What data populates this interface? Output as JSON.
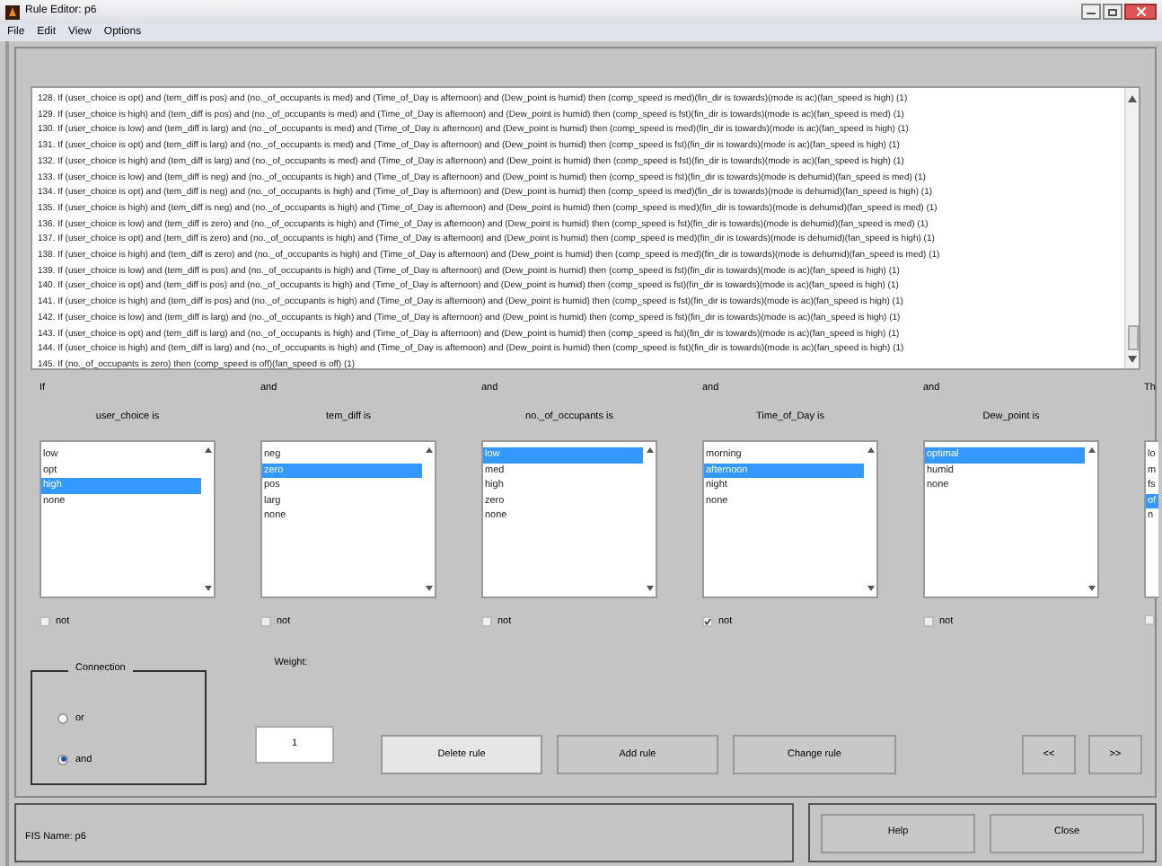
{
  "window": {
    "title": "Rule Editor: p6"
  },
  "menu": [
    "File",
    "Edit",
    "View",
    "Options"
  ],
  "rules": [
    "128. If (user_choice is opt) and (tem_diff is pos) and (no._of_occupants is med) and (Time_of_Day is afternoon) and (Dew_point is humid) then (comp_speed is med)(fin_dir is towards)(mode is ac)(fan_speed is high) (1)",
    "129. If (user_choice is high) and (tem_diff is pos) and (no._of_occupants is med) and (Time_of_Day is afternoon) and (Dew_point is humid) then (comp_speed is fst)(fin_dir is towards)(mode is ac)(fan_speed is med) (1)",
    "130. If (user_choice is low) and (tem_diff is larg) and (no._of_occupants is med) and (Time_of_Day is afternoon) and (Dew_point is humid) then (comp_speed is med)(fin_dir is towards)(mode is ac)(fan_speed is high) (1)",
    "131. If (user_choice is opt) and (tem_diff is larg) and (no._of_occupants is med) and (Time_of_Day is afternoon) and (Dew_point is humid) then (comp_speed is fst)(fin_dir is towards)(mode is ac)(fan_speed is high) (1)",
    "132. If (user_choice is high) and (tem_diff is larg) and (no._of_occupants is med) and (Time_of_Day is afternoon) and (Dew_point is humid) then (comp_speed is fst)(fin_dir is towards)(mode is ac)(fan_speed is high) (1)",
    "133. If (user_choice is low) and (tem_diff is neg) and (no._of_occupants is high) and (Time_of_Day is afternoon) and (Dew_point is humid) then (comp_speed is fst)(fin_dir is towards)(mode is dehumid)(fan_speed is med) (1)",
    "134. If (user_choice is opt) and (tem_diff is neg) and (no._of_occupants is high) and (Time_of_Day is afternoon) and (Dew_point is humid) then (comp_speed is med)(fin_dir is towards)(mode is dehumid)(fan_speed is high) (1)",
    "135. If (user_choice is high) and (tem_diff is neg) and (no._of_occupants is high) and (Time_of_Day is afternoon) and (Dew_point is humid) then (comp_speed is med)(fin_dir is towards)(mode is dehumid)(fan_speed is med) (1)",
    "136. If (user_choice is low) and (tem_diff is zero) and (no._of_occupants is high) and (Time_of_Day is afternoon) and (Dew_point is humid) then (comp_speed is fst)(fin_dir is towards)(mode is dehumid)(fan_speed is med) (1)",
    "137. If (user_choice is opt) and (tem_diff is zero) and (no._of_occupants is high) and (Time_of_Day is afternoon) and (Dew_point is humid) then (comp_speed is med)(fin_dir is towards)(mode is dehumid)(fan_speed is high) (1)",
    "138. If (user_choice is high) and (tem_diff is zero) and (no._of_occupants is high) and (Time_of_Day is afternoon) and (Dew_point is humid) then (comp_speed is med)(fin_dir is towards)(mode is dehumid)(fan_speed is med) (1)",
    "139. If (user_choice is low) and (tem_diff is pos) and (no._of_occupants is high) and (Time_of_Day is afternoon) and (Dew_point is humid) then (comp_speed is fst)(fin_dir is towards)(mode is ac)(fan_speed is high) (1)",
    "140. If (user_choice is opt) and (tem_diff is pos) and (no._of_occupants is high) and (Time_of_Day is afternoon) and (Dew_point is humid) then (comp_speed is fst)(fin_dir is towards)(mode is ac)(fan_speed is high) (1)",
    "141. If (user_choice is high) and (tem_diff is pos) and (no._of_occupants is high) and (Time_of_Day is afternoon) and (Dew_point is humid) then (comp_speed is fst)(fin_dir is towards)(mode is ac)(fan_speed is high) (1)",
    "142. If (user_choice is low) and (tem_diff is larg) and (no._of_occupants is high) and (Time_of_Day is afternoon) and (Dew_point is humid) then (comp_speed is fst)(fin_dir is towards)(mode is ac)(fan_speed is high) (1)",
    "143. If (user_choice is opt) and (tem_diff is larg) and (no._of_occupants is high) and (Time_of_Day is afternoon) and (Dew_point is humid) then (comp_speed is fst)(fin_dir is towards)(mode is ac)(fan_speed is high) (1)",
    "144. If (user_choice is high) and (tem_diff is larg) and (no._of_occupants is high) and (Time_of_Day is afternoon) and (Dew_point is humid) then (comp_speed is fst)(fin_dir is towards)(mode is ac)(fan_speed is high) (1)",
    "145. If (no._of_occupants is zero) then (comp_speed is off)(fan_speed is off) (1)"
  ],
  "variables": [
    {
      "connective": "If",
      "label": "user_choice is",
      "not": false,
      "not_label": "not",
      "options": [
        {
          "label": "low",
          "selected": false
        },
        {
          "label": "opt",
          "selected": false
        },
        {
          "label": "high",
          "selected": true
        },
        {
          "label": "none",
          "selected": false
        }
      ]
    },
    {
      "connective": "and",
      "label": "tem_diff is",
      "not": false,
      "not_label": "not",
      "options": [
        {
          "label": "neg",
          "selected": false
        },
        {
          "label": "zero",
          "selected": true
        },
        {
          "label": "pos",
          "selected": false
        },
        {
          "label": "larg",
          "selected": false
        },
        {
          "label": "none",
          "selected": false
        }
      ]
    },
    {
      "connective": "and",
      "label": "no._of_occupants is",
      "not": false,
      "not_label": "not",
      "options": [
        {
          "label": "low",
          "selected": true
        },
        {
          "label": "med",
          "selected": false
        },
        {
          "label": "high",
          "selected": false
        },
        {
          "label": "zero",
          "selected": false
        },
        {
          "label": "none",
          "selected": false
        }
      ]
    },
    {
      "connective": "and",
      "label": "Time_of_Day is",
      "not": true,
      "not_label": "not",
      "options": [
        {
          "label": "morning",
          "selected": false
        },
        {
          "label": "afternoon",
          "selected": true
        },
        {
          "label": "night",
          "selected": false
        },
        {
          "label": "none",
          "selected": false
        }
      ]
    },
    {
      "connective": "and",
      "label": "Dew_point is",
      "not": false,
      "not_label": "not",
      "options": [
        {
          "label": "optimal",
          "selected": true
        },
        {
          "label": "humid",
          "selected": false
        },
        {
          "label": "none",
          "selected": false
        }
      ]
    },
    {
      "connective": "Th",
      "not": false,
      "options": [
        {
          "label": "lo",
          "selected": false
        },
        {
          "label": "m",
          "selected": false
        },
        {
          "label": "fs",
          "selected": false
        },
        {
          "label": "of",
          "selected": true
        },
        {
          "label": "n",
          "selected": false
        }
      ]
    }
  ],
  "connection": {
    "title": "Connection",
    "options": [
      {
        "label": "or",
        "selected": false
      },
      {
        "label": "and",
        "selected": true
      }
    ]
  },
  "weight": {
    "label": "Weight:",
    "value": "1"
  },
  "buttons": [
    "Delete rule",
    "Add rule",
    "Change rule",
    "<<",
    ">>"
  ],
  "status": "FIS Name: p6",
  "footer_buttons": [
    "Help",
    "Close"
  ]
}
